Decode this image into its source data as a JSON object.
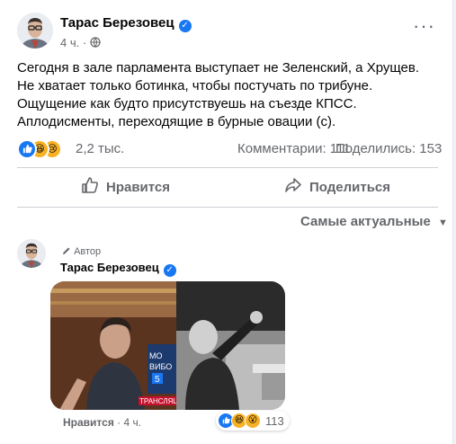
{
  "post": {
    "author": "Тарас Березовец",
    "time": "4 ч.",
    "privacy_icon": "globe-icon",
    "text": "Сегодня в зале парламента выступает не Зеленский, а Хрущев. Не хватает только ботинка, чтобы постучать по трибуне. Ощущение как будто присутствуешь на съезде КПСС. Аплодисменты, переходящие в бурные овации (с).",
    "reactions_count": "2,2 тыс.",
    "comments_label": "Комментарии: 111",
    "shares_label": "Поделились: 153"
  },
  "actions": {
    "like_label": "Нравится",
    "share_label": "Поделиться"
  },
  "sort": {
    "label": "Самые актуальные"
  },
  "comment": {
    "author_tag": "Автор",
    "author": "Тарас Березовец",
    "like_label": "Нравится",
    "separator": "·",
    "time": "4 ч.",
    "reactions_count": "113",
    "image_text": {
      "chan_top": "МО",
      "chan_mid": "ВИБО",
      "channel_num": "5",
      "live_tag": "ТРАНСЛЯЦІ"
    }
  },
  "colors": {
    "accent": "#1877f2",
    "secondary_text": "#65676b",
    "reaction_yellow": "#f7b125"
  }
}
